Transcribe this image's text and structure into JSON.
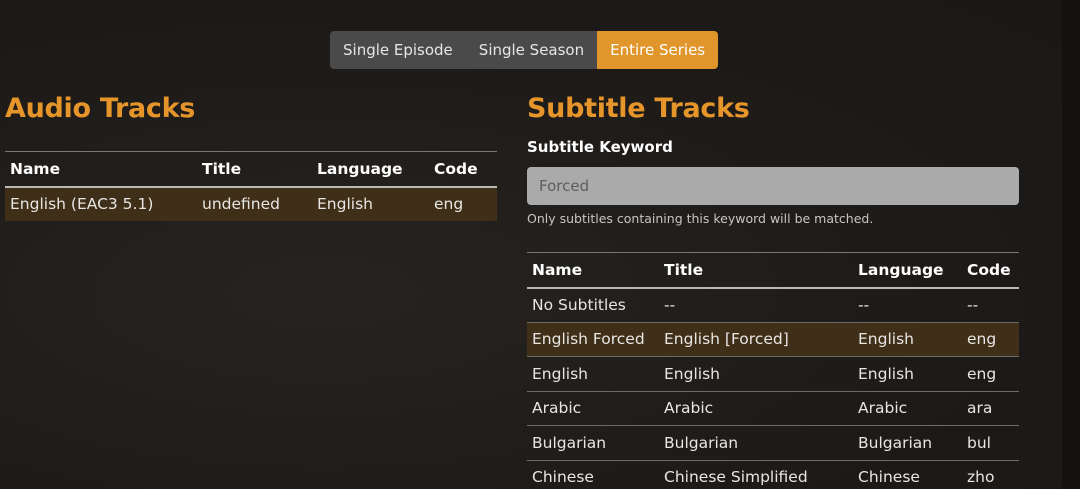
{
  "mode_selector": {
    "options": [
      "Single Episode",
      "Single Season",
      "Entire Series"
    ],
    "selected": "Entire Series"
  },
  "audio": {
    "title": "Audio Tracks",
    "columns": [
      "Name",
      "Title",
      "Language",
      "Code"
    ],
    "rows": [
      {
        "name": "English (EAC3 5.1)",
        "title": "undefined",
        "language": "English",
        "code": "eng",
        "selected": true
      }
    ]
  },
  "subtitles": {
    "title": "Subtitle Tracks",
    "keyword_label": "Subtitle Keyword",
    "keyword_placeholder": "Forced",
    "keyword_value": "",
    "keyword_help": "Only subtitles containing this keyword will be matched.",
    "columns": [
      "Name",
      "Title",
      "Language",
      "Code"
    ],
    "rows": [
      {
        "name": "No Subtitles",
        "title": "--",
        "language": "--",
        "code": "--",
        "selected": false
      },
      {
        "name": "English Forced",
        "title": "English [Forced]",
        "language": "English",
        "code": "eng",
        "selected": true
      },
      {
        "name": "English",
        "title": "English",
        "language": "English",
        "code": "eng",
        "selected": false
      },
      {
        "name": "Arabic",
        "title": "Arabic",
        "language": "Arabic",
        "code": "ara",
        "selected": false
      },
      {
        "name": "Bulgarian",
        "title": "Bulgarian",
        "language": "Bulgarian",
        "code": "bul",
        "selected": false
      },
      {
        "name": "Chinese",
        "title": "Chinese Simplified",
        "language": "Chinese",
        "code": "zho",
        "selected": false
      }
    ]
  },
  "colors": {
    "accent": "#e0962a",
    "heading": "#e6952b",
    "selected_row": "#3f2e18",
    "button_bg": "#4a4a4a"
  }
}
